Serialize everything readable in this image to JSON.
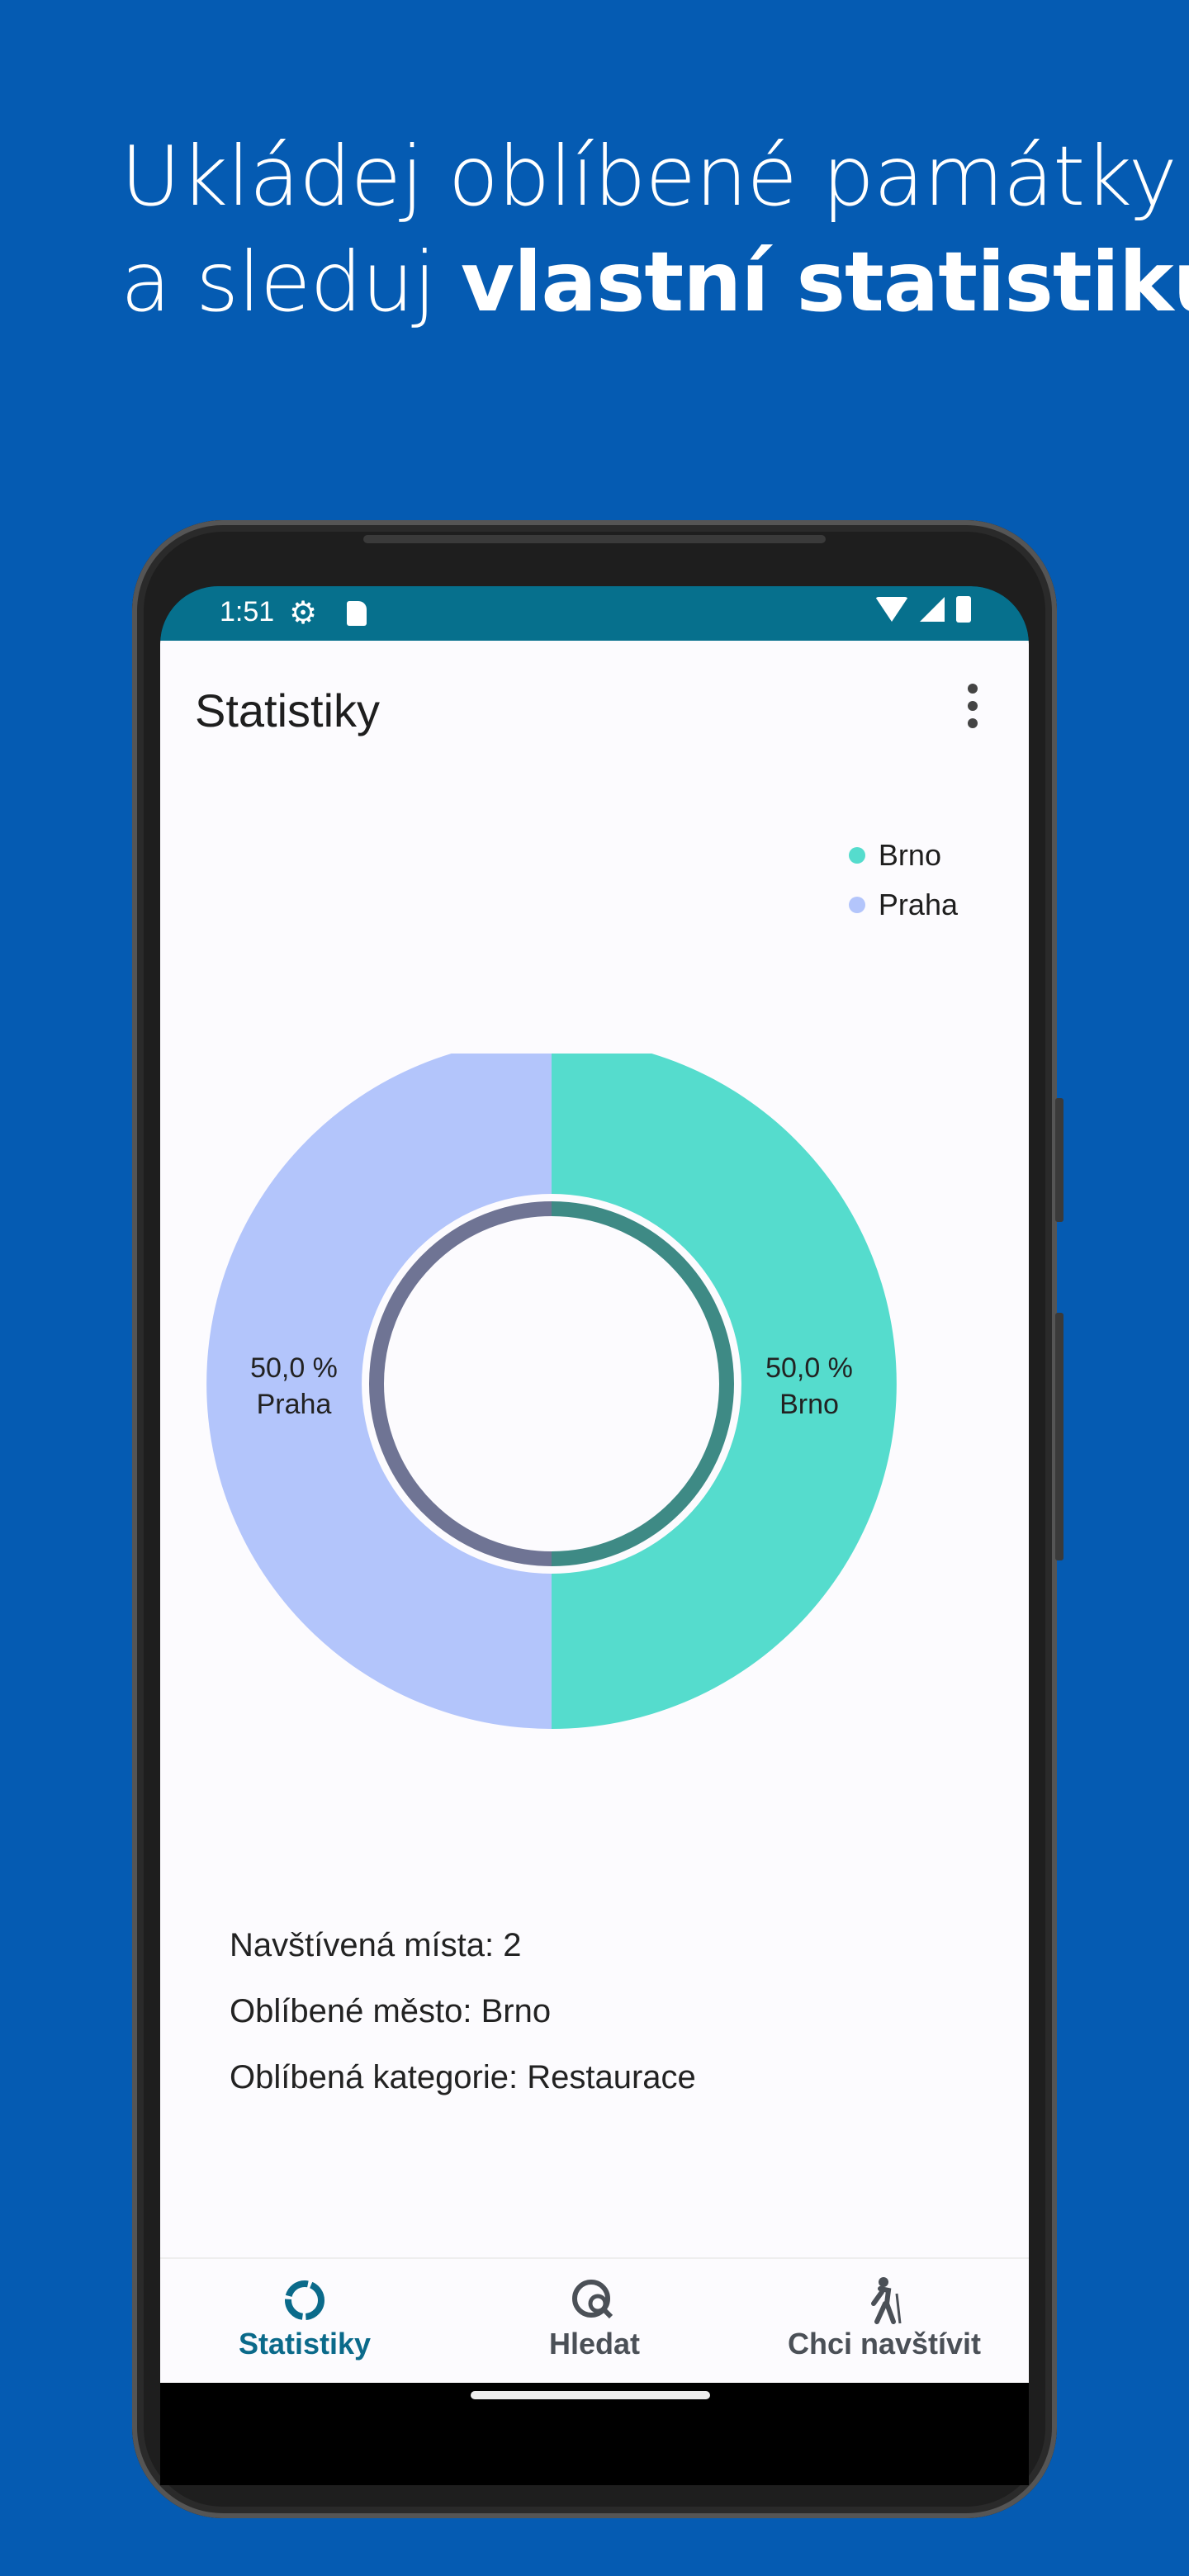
{
  "headline": {
    "line1": "Ukládej oblíbené památky",
    "line2_prefix": "a sleduj ",
    "line2_bold": "vlastní statistiku"
  },
  "statusbar": {
    "time": "1:51",
    "icons": [
      "gear-icon",
      "sd-card-icon",
      "wifi-icon",
      "signal-icon",
      "battery-icon"
    ]
  },
  "appbar": {
    "title": "Statistiky",
    "menu_icon": "more-vert-icon"
  },
  "colors": {
    "brno": "#55dccd",
    "praha": "#b3c5fb",
    "status_bar": "#06708d",
    "background": "#055bb2",
    "nav_active": "#0b6a8a"
  },
  "chart_data": {
    "type": "pie",
    "donut": true,
    "categories": [
      "Brno",
      "Praha"
    ],
    "values": [
      50.0,
      50.0
    ],
    "labels": [
      {
        "percent": "50,0 %",
        "name": "Brno"
      },
      {
        "percent": "50,0 %",
        "name": "Praha"
      }
    ],
    "legend": [
      "Brno",
      "Praha"
    ],
    "legend_position": "top-right"
  },
  "stats": {
    "visited": "Navštívená místa: 2",
    "favorite_city": "Oblíbené město: Brno",
    "favorite_category": "Oblíbená kategorie: Restaurace"
  },
  "bottom_nav": [
    {
      "label": "Statistiky",
      "icon": "donut-icon",
      "active": true
    },
    {
      "label": "Hledat",
      "icon": "search-globe-icon",
      "active": false
    },
    {
      "label": "Chci navštívit",
      "icon": "hiker-icon",
      "active": false
    }
  ]
}
